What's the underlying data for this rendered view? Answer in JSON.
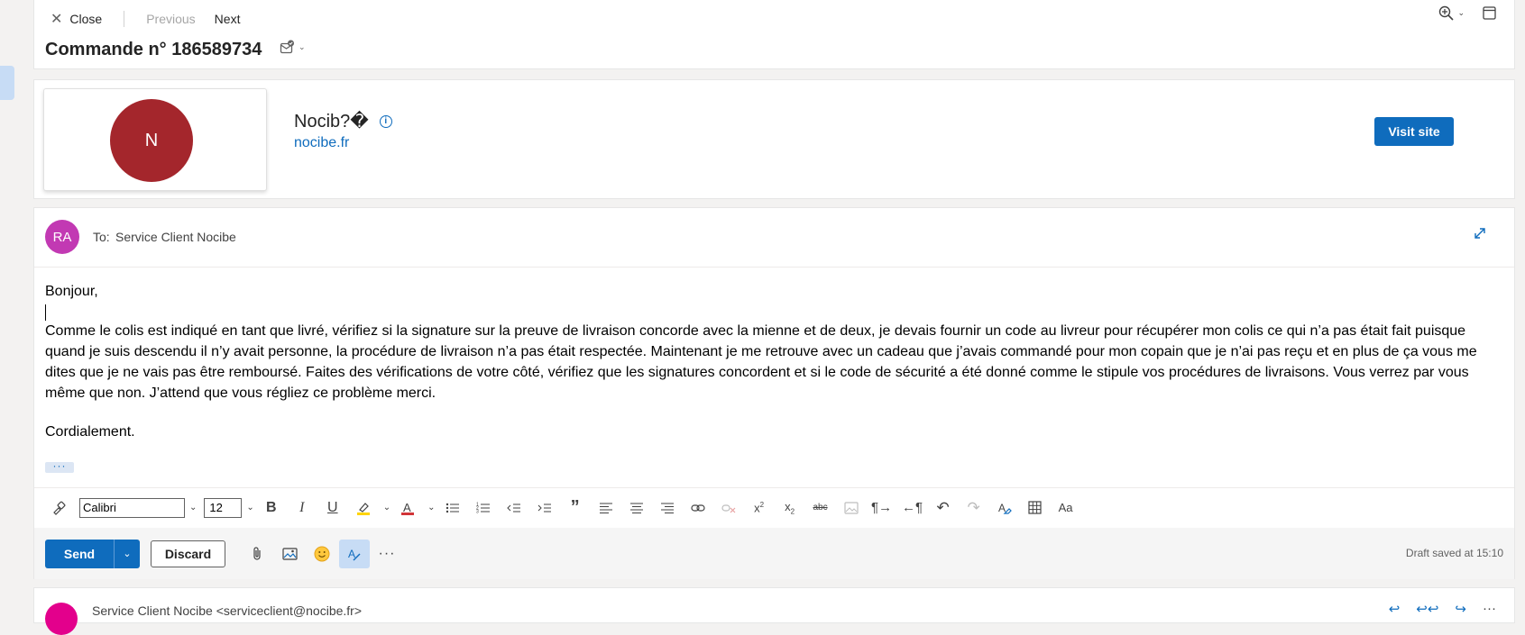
{
  "command_bar": {
    "close_label": "Close",
    "previous_label": "Previous",
    "next_label": "Next"
  },
  "message": {
    "subject": "Commande n° 186589734"
  },
  "sender": {
    "initial": "N",
    "name": "Nocib?�",
    "domain": "nocibe.fr",
    "visit_label": "Visit site",
    "brand_color": "#a4262c"
  },
  "compose": {
    "avatar_initials": "RA",
    "to_label": "To:",
    "to_value": "Service Client Nocibe",
    "body": {
      "greeting": "Bonjour,",
      "paragraph": " Comme le colis est indiqué en tant que livré, vérifiez si la signature sur la preuve de livraison concorde avec la mienne et de deux, je devais fournir un code au livreur pour récupérer mon colis ce qui n’a pas était fait puisque quand je suis descendu il n’y avait personne, la procédure de livraison n’a pas était respectée. Maintenant je me retrouve avec un cadeau que j’avais commandé pour mon copain que je n’ai pas reçu et en plus de ça vous me dites que je ne vais pas être remboursé. Faites des vérifications de votre côté, vérifiez que les signatures concordent et si le code de sécurité a été donné comme le stipule vos procédures de livraisons. Vous verrez par vous même que non. J’attend que vous régliez ce problème merci.",
      "closing": "Cordialement."
    },
    "more_label": "···",
    "format": {
      "font": "Calibri",
      "size": "12"
    },
    "send_label": "Send",
    "discard_label": "Discard",
    "draft_status": "Draft saved at 15:10"
  },
  "next_message": {
    "from": "Service Client Nocibe <serviceclient@nocibe.fr>"
  },
  "colors": {
    "accent": "#0f6cbd",
    "avatar_ra": "#c239b3",
    "avatar_next": "#e3008c"
  }
}
